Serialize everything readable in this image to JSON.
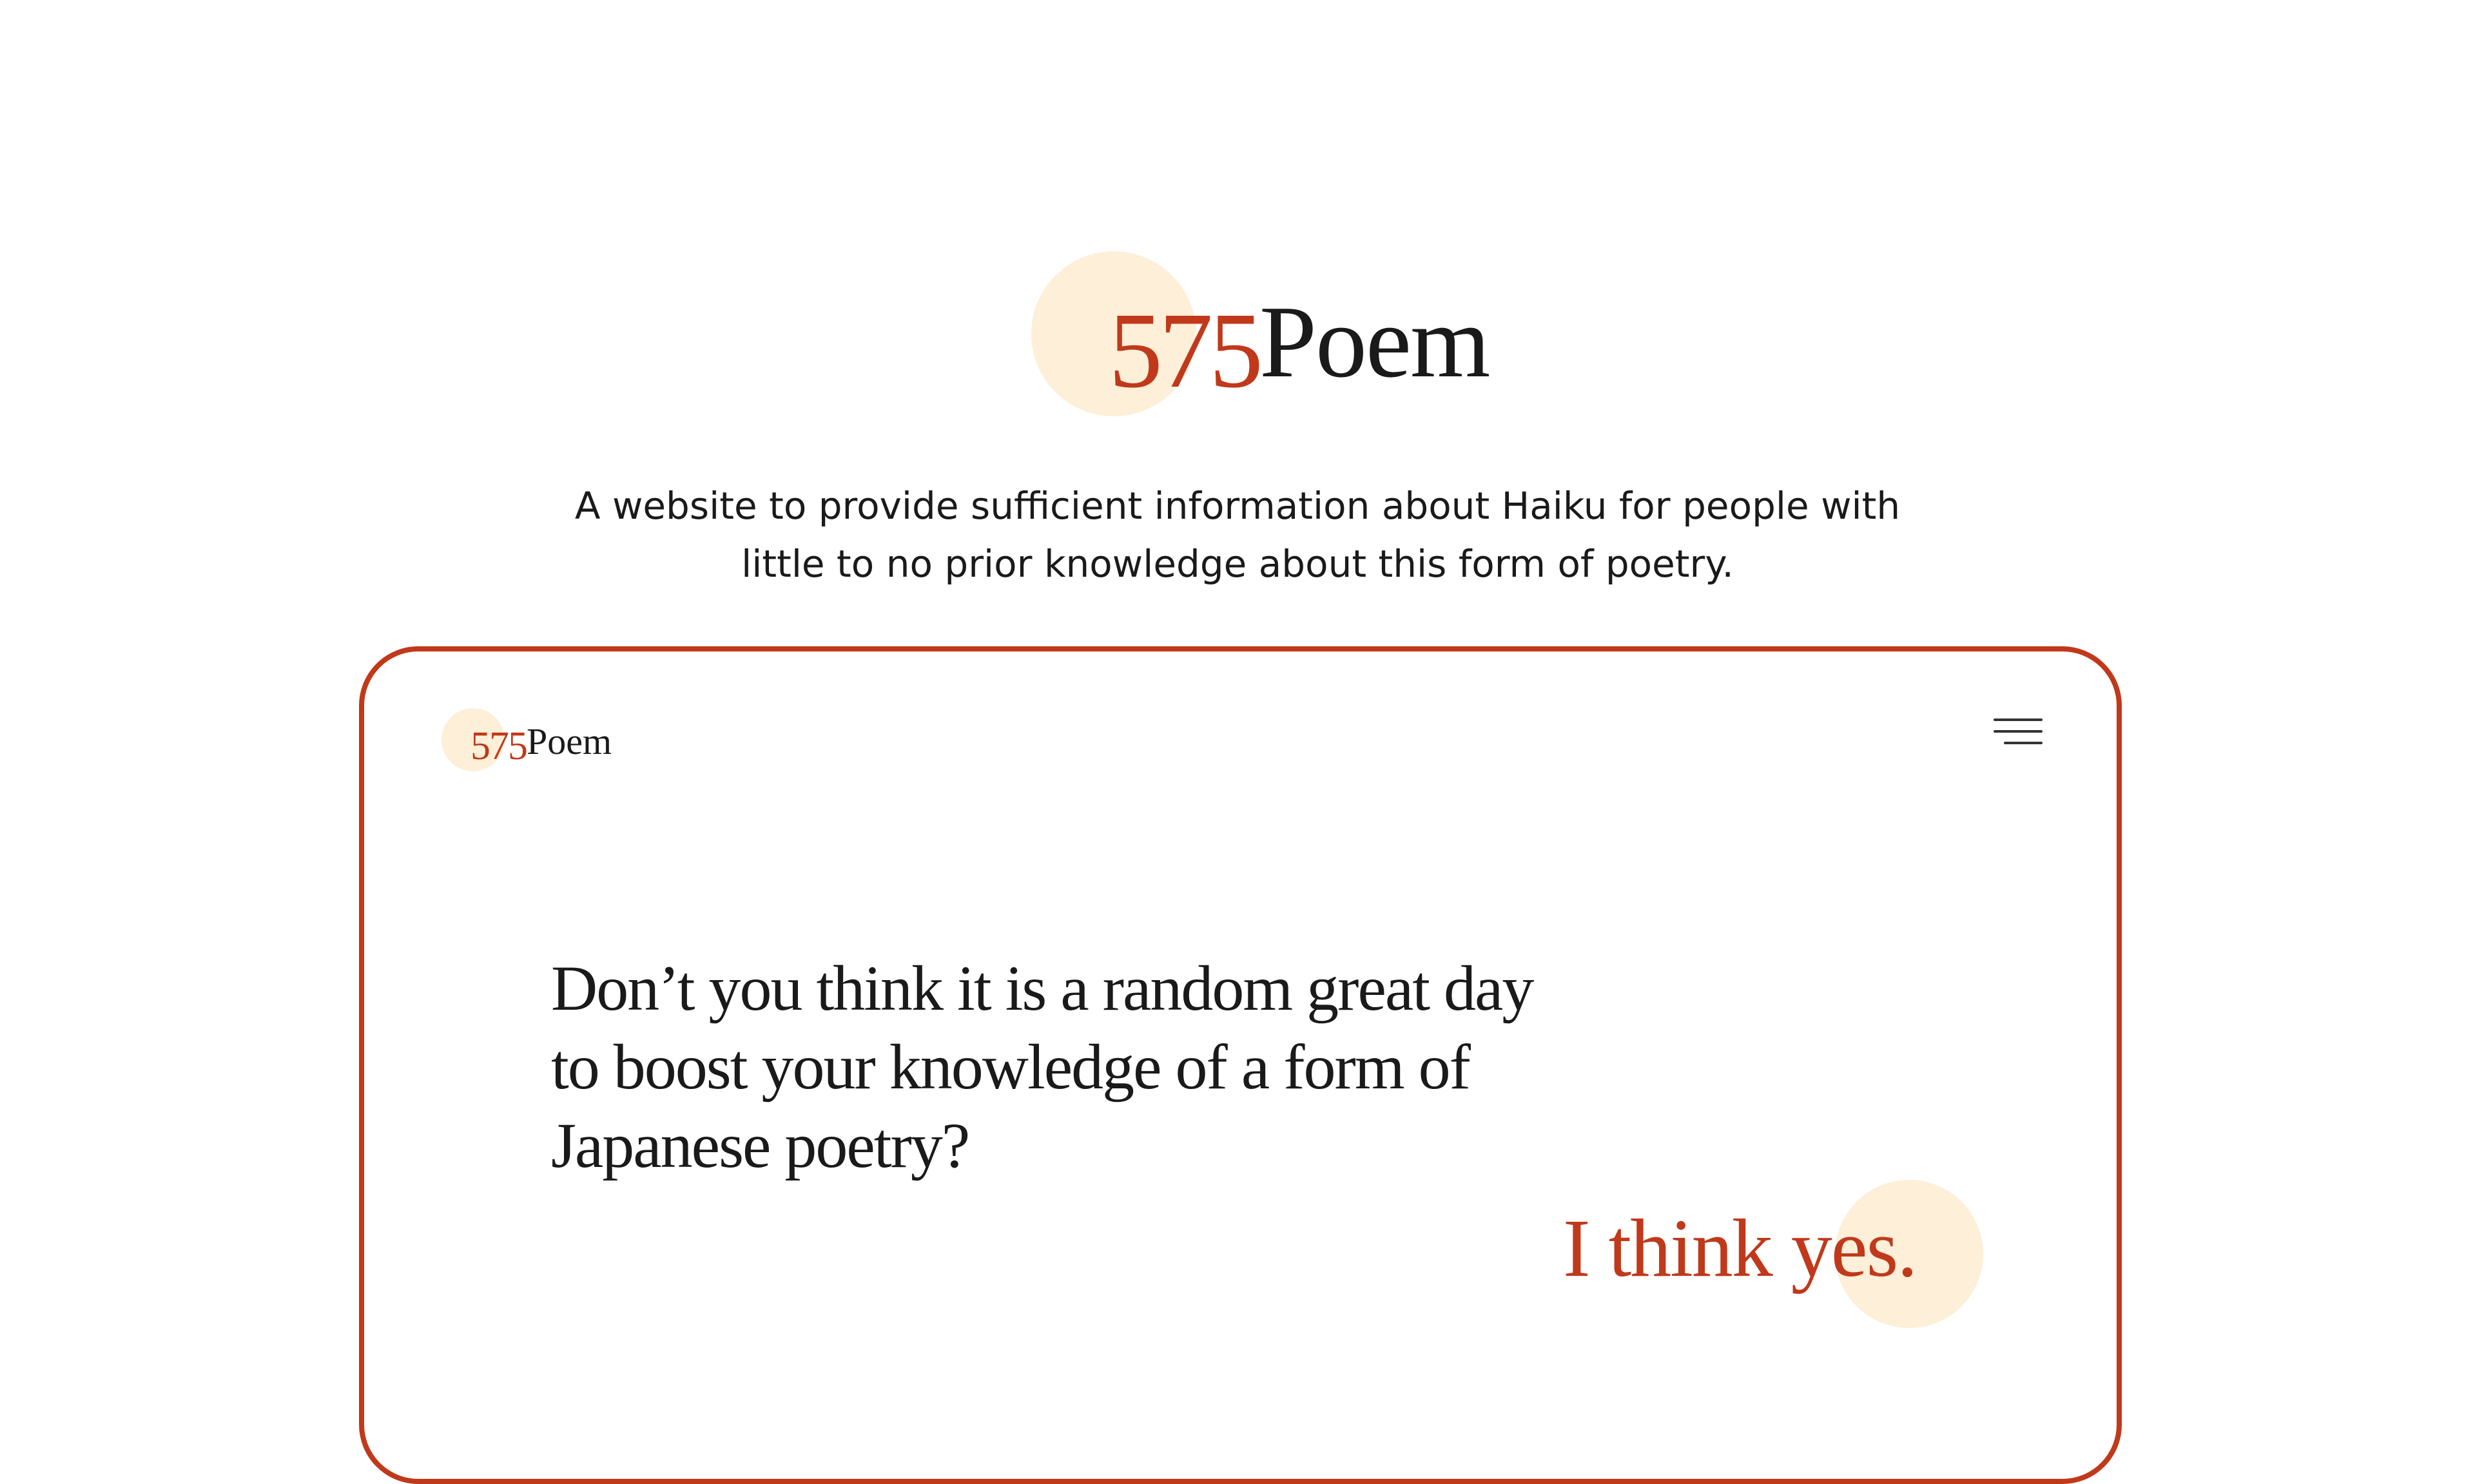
{
  "header": {
    "logo": {
      "number": "575",
      "word": "Poem"
    },
    "tagline": [
      "A website to provide sufficient information about Haiku for people with",
      "little to no prior knowledge about this form of poetry."
    ]
  },
  "mockup": {
    "logo": {
      "number": "575",
      "word": "Poem"
    },
    "menu_icon": "hamburger-menu-icon",
    "headline": [
      "Don’t you think it is a random great day",
      "to boost your knowledge of a form of",
      "Japanese poetry?"
    ],
    "answer": "I think yes."
  },
  "colors": {
    "accent": "#c0391b",
    "highlight": "#fdefd8",
    "text": "#1a1a1a",
    "background": "#ffffff"
  }
}
